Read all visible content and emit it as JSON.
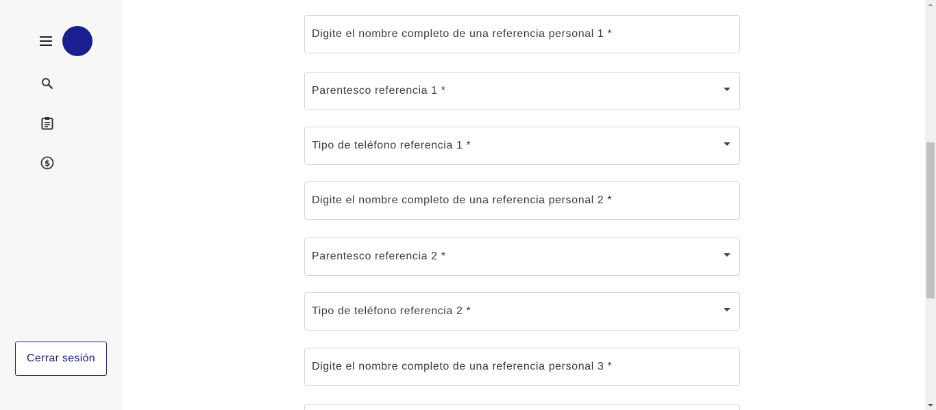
{
  "sidebar": {
    "menu_icon": "hamburger-menu-icon",
    "avatar_color": "#1a1f8f",
    "nav_items": [
      {
        "icon": "search-icon"
      },
      {
        "icon": "clipboard-icon"
      },
      {
        "icon": "dollar-coin-icon"
      }
    ],
    "logout_label": "Cerrar sesión"
  },
  "form": {
    "fields": [
      {
        "label": "Digite el nombre completo de una referencia personal 1 *",
        "type": "text"
      },
      {
        "label": "Parentesco referencia 1 *",
        "type": "select"
      },
      {
        "label": "Tipo de teléfono referencia 1 *",
        "type": "select"
      },
      {
        "label": "Digite el nombre completo de una referencia personal 2 *",
        "type": "text"
      },
      {
        "label": "Parentesco referencia 2 *",
        "type": "select"
      },
      {
        "label": "Tipo de teléfono referencia 2 *",
        "type": "select"
      },
      {
        "label": "Digite el nombre completo de una referencia personal 3 *",
        "type": "text"
      }
    ]
  },
  "colors": {
    "accent": "#1a237e",
    "sidebar_bg": "#f7f7f7",
    "field_border": "#d6d6d6"
  }
}
